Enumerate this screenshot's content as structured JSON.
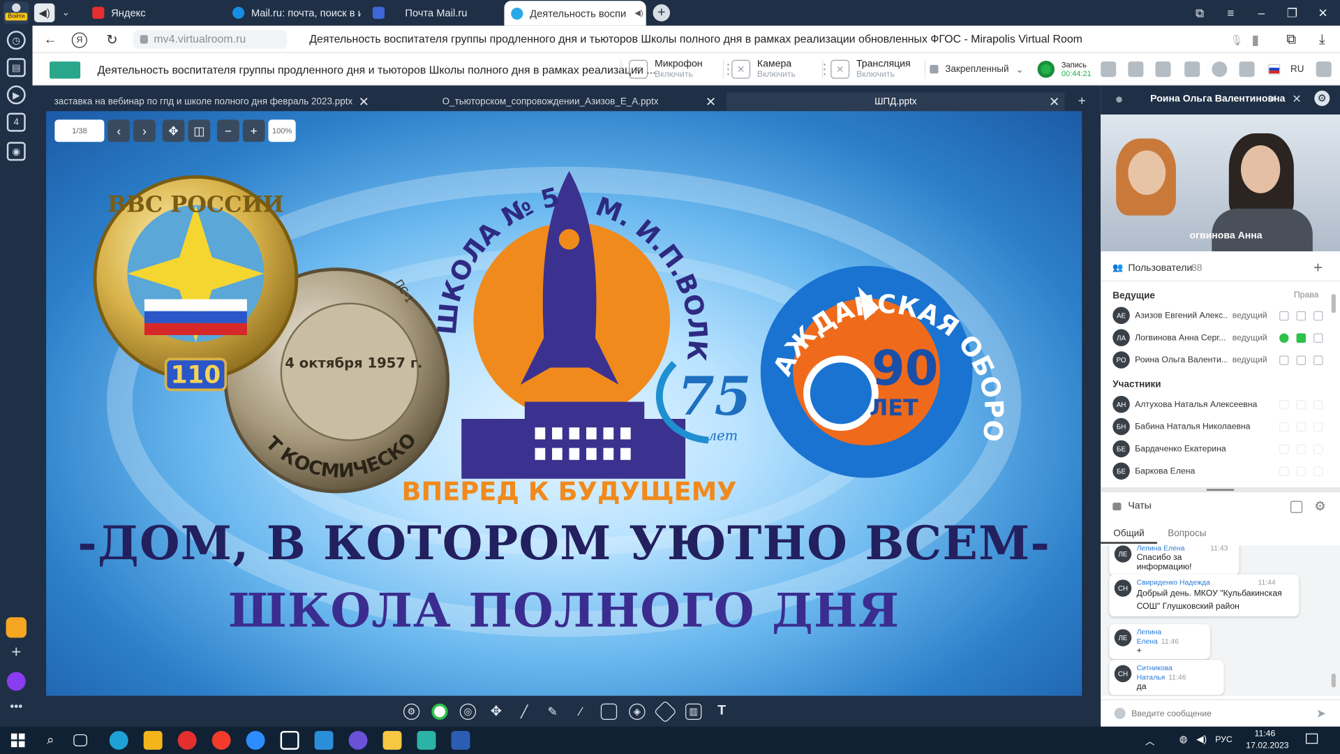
{
  "browser": {
    "login_label": "Войти",
    "tabs": [
      {
        "label": "Яндекс",
        "active": false
      },
      {
        "label": "Mail.ru: почта, поиск в ин",
        "active": false
      },
      {
        "label": "Почта Mail.ru",
        "active": false
      },
      {
        "label": "Деятельность воспи",
        "active": true
      }
    ],
    "url": "mv4.virtualroom.ru",
    "page_title": "Деятельность воспитателя группы продленного дня и тьюторов Школы полного дня в рамках реализации обновленных ФГОС - Mirapolis Virtual Room"
  },
  "app": {
    "title": "Деятельность воспитателя группы продленного дня и тьюторов Школы полного дня в рамках реализации ...",
    "microphone": {
      "label": "Микрофон",
      "action": "Включить"
    },
    "camera": {
      "label": "Камера",
      "action": "Включить"
    },
    "broadcast": {
      "label": "Трансляция",
      "action": "Включить"
    },
    "pinned_label": "Закрепленный",
    "recording": {
      "label": "Запись",
      "time": "00:44:21"
    },
    "language": "RU"
  },
  "presentation": {
    "tabs": [
      {
        "label": "заставка на вебинар по гпд и школе полного дня февраль 2023.pptx"
      },
      {
        "label": "О_тьюторском_сопровождении_Азизов_Е_А.pptx"
      },
      {
        "label": "ШПД.pptx"
      }
    ],
    "page": "1/38",
    "zoom": "100%",
    "slide": {
      "medal1_top": "ВВС РОССИИ",
      "medal1_num": "110",
      "medal2_ring": "65 ЛЕТ КОСМИЧЕСКОЙ ЭРЫ",
      "medal2_date": "4 октября 1957 г.",
      "medal2_ps": "ПС-1",
      "school_arc_left": "ШКОЛА № 5",
      "school_arc_right": "ИМ. И.П.ВОЛКА",
      "school_motto": "ВПЕРЕД К БУДУЩЕМУ",
      "anniv_num": "75",
      "anniv_word": "лет",
      "civil_ring": "ГРАЖДАНСКАЯ ОБОРОНА",
      "civil_num": "90",
      "civil_word": "ЛЕТ",
      "line1": "-ДОМ, В КОТОРОМ УЮТНО ВСЕМ-",
      "line2": "ШКОЛА ПОЛНОГО ДНЯ"
    }
  },
  "right_panel": {
    "presenter_name": "Роина Ольга Валентиновна",
    "video_caption": "огвинова Анна",
    "users_label": "Пользователи",
    "users_count": "88",
    "hosts_label": "Ведущие",
    "rights_label": "Права",
    "hosts": [
      {
        "initials": "АЕ",
        "name": "Азизов Евгений Алекс...",
        "role": "ведущий"
      },
      {
        "initials": "ЛА",
        "name": "Логвинова Анна Серг...",
        "role": "ведущий"
      },
      {
        "initials": "РО",
        "name": "Роина Ольга Валенти...",
        "role": "ведущий"
      }
    ],
    "participants_label": "Участники",
    "participants": [
      {
        "initials": "АН",
        "name": "Алтухова Наталья Алексеевна"
      },
      {
        "initials": "БН",
        "name": "Бабина Наталья Николаевна"
      },
      {
        "initials": "БЕ",
        "name": "Бардаченко Екатерина"
      },
      {
        "initials": "БЕ",
        "name": "Баркова Елена"
      }
    ],
    "chats_label": "Чаты",
    "chat_tabs": [
      "Общий",
      "Вопросы"
    ],
    "messages": [
      {
        "initials": "ЛЕ",
        "author": "Лепина Елена",
        "time": "11:43",
        "text": "Спасибо за информацию!"
      },
      {
        "initials": "СН",
        "author": "Свириденко Надежда",
        "time": "11:44",
        "text": "Добрый день. МКОУ \"Кульбакинская СОШ\" Глушковский район"
      },
      {
        "initials": "ЛЕ",
        "author": "Лепина Елена",
        "time": "11:46",
        "text": "+"
      },
      {
        "initials": "СН",
        "author": "Ситникова Наталья",
        "time": "11:46",
        "text": "да"
      }
    ],
    "message_placeholder": "Введите сообщение"
  },
  "taskbar": {
    "language": "РУС",
    "time": "11:46",
    "date": "17.02.2023"
  }
}
